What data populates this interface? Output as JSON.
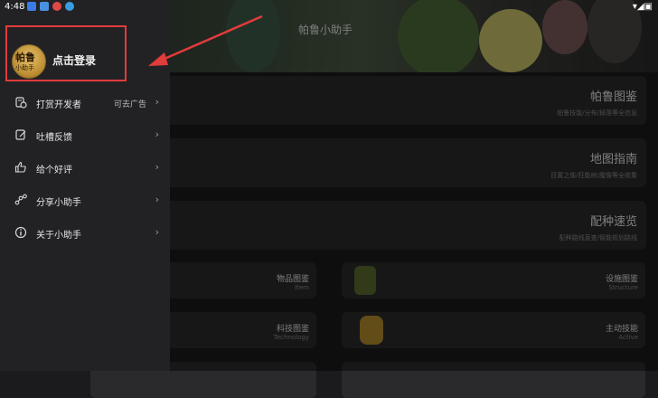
{
  "status_bar": {
    "time": "4:48",
    "system_icons": "▾◢▣"
  },
  "header": {
    "title": "帕鲁小助手"
  },
  "drawer": {
    "avatar_line1": "帕鲁",
    "avatar_line2": "小助手",
    "login_label": "点击登录",
    "items": [
      {
        "label": "打赏开发者",
        "extra": "可去广告",
        "icon": "coin-stack-icon"
      },
      {
        "label": "吐槽反馈",
        "extra": "",
        "icon": "edit-icon"
      },
      {
        "label": "给个好评",
        "extra": "",
        "icon": "thumbs-up-icon"
      },
      {
        "label": "分享小助手",
        "extra": "",
        "icon": "share-icon"
      },
      {
        "label": "关于小助手",
        "extra": "",
        "icon": "info-icon"
      }
    ],
    "chevron": "›"
  },
  "cards": [
    {
      "title": "帕鲁图鉴",
      "subtitle": "帕鲁技能/分布/掉落等全信息"
    },
    {
      "title": "地图指南",
      "subtitle": "目置之像/狂能树/魔像等全收集"
    },
    {
      "title": "配种速览",
      "subtitle": "配种路线直查/智能规划路线"
    }
  ],
  "grid": [
    {
      "title": "物品图鉴",
      "subtitle": "Item"
    },
    {
      "title": "设施图鉴",
      "subtitle": "Structure"
    },
    {
      "title": "科技图鉴",
      "subtitle": "Technology"
    },
    {
      "title": "主动技能",
      "subtitle": "Active"
    }
  ],
  "colors": {
    "highlight": "#e23b3b",
    "drawer_bg": "#222225",
    "card_bg": "#2a2a2d"
  }
}
